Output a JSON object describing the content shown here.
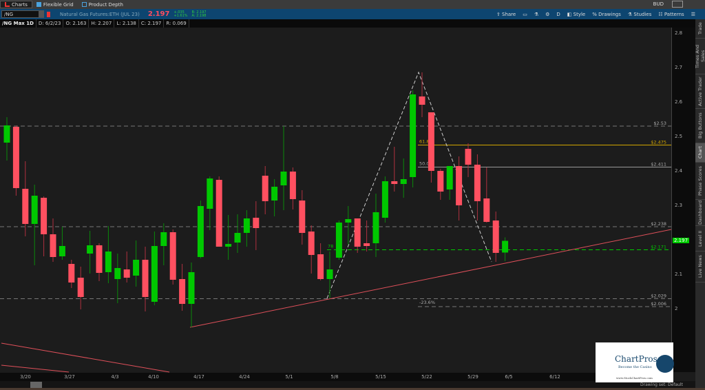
{
  "tabs": [
    {
      "label": "Charts",
      "icon": "bar-chart-icon",
      "active": true
    },
    {
      "label": "Flexible Grid",
      "icon": "grid-icon"
    },
    {
      "label": "Product Depth",
      "icon": "depth-icon"
    }
  ],
  "account": "BUD",
  "symbol": {
    "value": "/NG",
    "description": "Natural Gas Futures:ETH (JUL 23)",
    "last": "2.197",
    "change": "+.035",
    "change_pct": "+1.61%",
    "bid": "B: 2.197",
    "ask": "A: 2.198"
  },
  "toolbar": {
    "share": "Share",
    "period": "D",
    "style": "Style",
    "drawings": "Drawings",
    "studies": "Studies",
    "patterns": "Patterns"
  },
  "info": {
    "title": "/NG Max 1D",
    "date": "D: 6/2/23",
    "open": "O: 2.163",
    "high": "H: 2.207",
    "low": "L: 2.138",
    "close": "C: 2.197",
    "range": "R: 0.069"
  },
  "side_tabs": [
    "Trade",
    "Times And Sales",
    "Active Trader",
    "Big Buttons",
    "Chart",
    "Phase Scores",
    "Dashboard",
    "Level II",
    "Live News"
  ],
  "active_side_tab": "Chart",
  "logo": {
    "name": "ChartPros",
    "tagline": "Become the Casino",
    "url": "www.StockChartPros.com"
  },
  "drawing_set": "Drawing set: Default",
  "colors": {
    "up": "#00c800",
    "down": "#ff5060",
    "trend": "#e0505a",
    "fib61": "#d4a800",
    "sel": "#00cc00"
  },
  "chart_data": {
    "type": "candlestick",
    "ylim": [
      1.82,
      2.84
    ],
    "y_ticks": [
      "2.8",
      "2.7",
      "2.6",
      "2.5",
      "2.4",
      "2.3",
      "2.2",
      "2.1",
      "2"
    ],
    "x_ticks": [
      "3/20",
      "3/27",
      "4/3",
      "4/10",
      "4/17",
      "4/24",
      "5/1",
      "5/8",
      "5/15",
      "5/22",
      "5/29",
      "6/5",
      "6/12"
    ],
    "current_price": "2.197",
    "levels": [
      {
        "label": "$2.53",
        "value": 2.53,
        "style": "dashed"
      },
      {
        "label": "$2.475",
        "value": 2.475,
        "style": "fib61"
      },
      {
        "label": "$2.411",
        "value": 2.411,
        "style": "fib50"
      },
      {
        "label": "$2.238",
        "value": 2.238,
        "style": "dashed"
      },
      {
        "label": "$2.171",
        "value": 2.171,
        "style": "green"
      },
      {
        "label": "$2.029",
        "value": 2.029,
        "style": "dashed"
      },
      {
        "label": "$2.006",
        "value": 2.006,
        "style": "fib-236"
      }
    ],
    "fib_labels": {
      "f618": "61.8%",
      "f50": "50.0%",
      "f236": "-23.6%",
      "f78": "78"
    },
    "ohlc": [
      [
        2.482,
        2.556,
        2.43,
        2.532
      ],
      [
        2.528,
        2.532,
        2.328,
        2.35
      ],
      [
        2.348,
        2.428,
        2.21,
        2.246
      ],
      [
        2.246,
        2.36,
        2.126,
        2.328
      ],
      [
        2.322,
        2.326,
        2.152,
        2.216
      ],
      [
        2.216,
        2.262,
        2.136,
        2.15
      ],
      [
        2.152,
        2.238,
        2.142,
        2.182
      ],
      [
        2.13,
        2.142,
        2.06,
        2.076
      ],
      [
        2.09,
        2.122,
        1.998,
        2.034
      ],
      [
        2.16,
        2.226,
        2.102,
        2.184
      ],
      [
        2.184,
        2.19,
        2.08,
        2.104
      ],
      [
        2.106,
        2.24,
        2.074,
        2.166
      ],
      [
        2.086,
        2.16,
        2.016,
        2.118
      ],
      [
        2.114,
        2.166,
        2.076,
        2.09
      ],
      [
        2.096,
        2.198,
        2.064,
        2.142
      ],
      [
        2.142,
        2.18,
        1.992,
        2.034
      ],
      [
        2.02,
        2.224,
        2.01,
        2.182
      ],
      [
        2.182,
        2.248,
        2.126,
        2.222
      ],
      [
        2.222,
        2.23,
        2.07,
        2.084
      ],
      [
        2.086,
        2.13,
        1.994,
        2.014
      ],
      [
        2.014,
        2.134,
        1.946,
        2.106
      ],
      [
        2.15,
        2.314,
        2.146,
        2.298
      ],
      [
        2.29,
        2.384,
        2.228,
        2.378
      ],
      [
        2.374,
        2.384,
        2.18,
        2.18
      ],
      [
        2.18,
        2.272,
        2.142,
        2.188
      ],
      [
        2.192,
        2.274,
        2.162,
        2.22
      ],
      [
        2.22,
        2.286,
        2.18,
        2.262
      ],
      [
        2.264,
        2.312,
        2.17,
        2.234
      ],
      [
        2.386,
        2.414,
        2.274,
        2.312
      ],
      [
        2.314,
        2.376,
        2.268,
        2.354
      ],
      [
        2.358,
        2.53,
        2.286,
        2.398
      ],
      [
        2.398,
        2.41,
        2.288,
        2.318
      ],
      [
        2.314,
        2.344,
        2.186,
        2.22
      ],
      [
        2.224,
        2.242,
        2.102,
        2.156
      ],
      [
        2.158,
        2.19,
        2.082,
        2.086
      ],
      [
        2.086,
        2.166,
        2.03,
        2.114
      ],
      [
        2.148,
        2.256,
        2.142,
        2.25
      ],
      [
        2.25,
        2.298,
        2.186,
        2.26
      ],
      [
        2.262,
        2.262,
        2.162,
        2.18
      ],
      [
        2.19,
        2.256,
        2.166,
        2.182
      ],
      [
        2.19,
        2.334,
        2.15,
        2.28
      ],
      [
        2.264,
        2.384,
        2.25,
        2.37
      ],
      [
        2.37,
        2.47,
        2.34,
        2.362
      ],
      [
        2.362,
        2.436,
        2.322,
        2.376
      ],
      [
        2.382,
        2.634,
        2.352,
        2.622
      ],
      [
        2.616,
        2.686,
        2.556,
        2.592
      ],
      [
        2.57,
        2.57,
        2.366,
        2.4
      ],
      [
        2.4,
        2.406,
        2.316,
        2.34
      ],
      [
        2.346,
        2.414,
        2.316,
        2.414
      ],
      [
        2.414,
        2.442,
        2.256,
        2.3
      ],
      [
        2.464,
        2.48,
        2.382,
        2.418
      ],
      [
        2.418,
        2.448,
        2.256,
        2.312
      ],
      [
        2.32,
        2.41,
        2.25,
        2.252
      ],
      [
        2.256,
        2.282,
        2.136,
        2.162
      ],
      [
        2.163,
        2.207,
        2.138,
        2.197
      ]
    ]
  }
}
